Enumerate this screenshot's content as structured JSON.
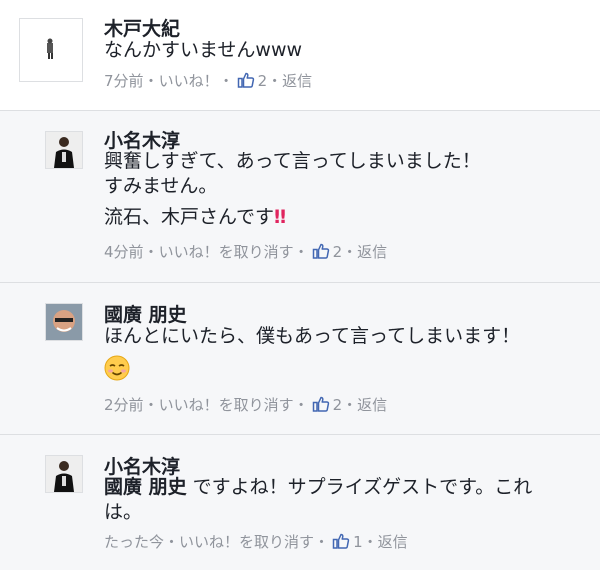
{
  "comments": [
    {
      "author": "木戸大紀",
      "lines": [
        "なんかすいませんwww"
      ],
      "time": "7分前",
      "action": "いいね！",
      "likes": "2",
      "reply": "返信"
    },
    {
      "author": "小名木淳",
      "lines": [
        "興奮しすぎて、あって言ってしまいました！",
        "すみません。",
        "流石、木戸さんです"
      ],
      "emoji_suffix": "‼",
      "time": "4分前",
      "action": "いいね！を取り消す",
      "likes": "2",
      "reply": "返信"
    },
    {
      "author": "國廣 朋史",
      "lines": [
        "ほんとにいたら、僕もあって言ってしまいます！"
      ],
      "emoji": "relieved-smile",
      "time": "2分前",
      "action": "いいね！を取り消す",
      "likes": "2",
      "reply": "返信"
    },
    {
      "author": "小名木淳",
      "mention": "國廣 朋史",
      "lines": [
        " ですよね！サプライズゲストです。これ",
        "は。"
      ],
      "time": "たった今",
      "action": "いいね！を取り消す",
      "likes": "1",
      "reply": "返信"
    }
  ],
  "separator": "・",
  "colors": {
    "meta": "#90949c",
    "like_blue": "#4267b2",
    "bg_thread": "#f6f7f9"
  }
}
